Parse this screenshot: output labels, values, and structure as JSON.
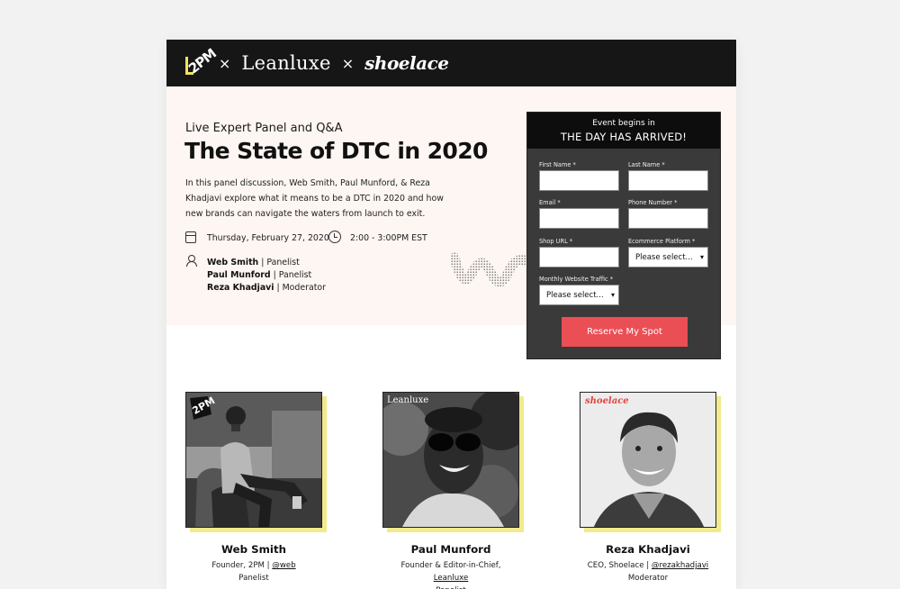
{
  "brand": {
    "logo_2pm": "2PM",
    "separator": "×",
    "logo_leanluxe": "Leanluxe",
    "logo_shoelace": "shoelace"
  },
  "hero": {
    "eyebrow": "Live Expert Panel and Q&A",
    "title": "The State of DTC in 2020",
    "description": "In this panel discussion, Web Smith, Paul Munford, & Reza Khadjavi explore what it means to be a DTC in 2020 and how new brands can navigate the waters from launch to exit.",
    "date": "Thursday, February 27, 2020",
    "time": "2:00 - 3:00PM EST",
    "people": [
      {
        "name": "Web Smith",
        "role": "Panelist"
      },
      {
        "name": "Paul Munford",
        "role": "Panelist"
      },
      {
        "name": "Reza Khadjavi",
        "role": "Moderator"
      }
    ],
    "role_separator": " | "
  },
  "form": {
    "small_header": "Event begins in",
    "large_header": "THE DAY HAS ARRIVED!",
    "fields": {
      "first_name": "First Name *",
      "last_name": "Last Name *",
      "email": "Email *",
      "phone": "Phone Number *",
      "shop_url": "Shop URL *",
      "platform": "Ecommerce Platform *",
      "traffic": "Monthly Website Traffic *"
    },
    "select_placeholder": "Please select...",
    "submit": "Reserve My Spot"
  },
  "speakers": [
    {
      "name": "Web Smith",
      "title": "Founder, 2PM | ",
      "link": "@web",
      "role": "Panelist",
      "badge": "2PM"
    },
    {
      "name": "Paul Munford",
      "title": "Founder & Editor-in-Chief, ",
      "link": "Leanluxe",
      "role": "Panelist",
      "badge": "Leanluxe"
    },
    {
      "name": "Reza Khadjavi",
      "title": "CEO, Shoelace | ",
      "link": "@rezakhadjavi",
      "role": "Moderator",
      "badge": "shoelace"
    }
  ],
  "colors": {
    "topbar": "#161616",
    "hero_bg": "#fdf6f2",
    "form_bg": "#3a3a3a",
    "cta": "#ea4f55",
    "photo_shadow": "#f1ea8e",
    "accent_yellow": "#f2e45c",
    "shoelace_red": "#e0463f"
  }
}
